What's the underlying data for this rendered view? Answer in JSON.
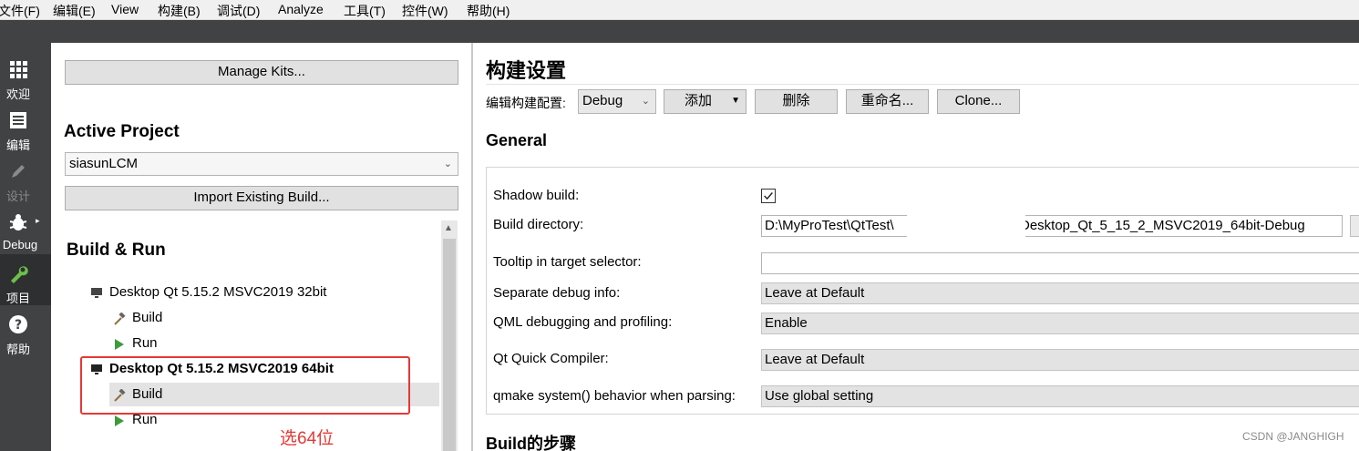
{
  "menu": [
    "文件(F)",
    "编辑(E)",
    "View",
    "构建(B)",
    "调试(D)",
    "Analyze",
    "工具(T)",
    "控件(W)",
    "帮助(H)"
  ],
  "modes": [
    {
      "label": "欢迎",
      "icon": "grid-icon"
    },
    {
      "label": "编辑",
      "icon": "document-icon"
    },
    {
      "label": "设计",
      "icon": "pencil-icon"
    },
    {
      "label": "Debug",
      "icon": "bug-icon"
    },
    {
      "label": "项目",
      "icon": "wrench-icon"
    },
    {
      "label": "帮助",
      "icon": "question-icon"
    }
  ],
  "left": {
    "manage_kits": "Manage Kits...",
    "active_project_title": "Active Project",
    "project_combo": "siasunLCM",
    "import_build": "Import Existing Build...",
    "build_run_title": "Build & Run",
    "kits": [
      {
        "name": "Desktop Qt 5.15.2 MSVC2019 32bit",
        "build": "Build",
        "run": "Run"
      },
      {
        "name": "Desktop Qt 5.15.2 MSVC2019 64bit",
        "build": "Build",
        "run": "Run"
      }
    ],
    "annotation": "选64位"
  },
  "right": {
    "title": "构建设置",
    "edit_config_label": "编辑构建配置:",
    "config_combo": "Debug",
    "add_button": "添加",
    "delete_button": "删除",
    "rename_button": "重命名...",
    "clone_button": "Clone...",
    "general_title": "General",
    "rows": {
      "shadow_build": "Shadow build:",
      "build_directory": "Build directory:",
      "build_directory_value_left": "D:\\MyProTest\\QtTest\\",
      "build_directory_value_right": "Desktop_Qt_5_15_2_MSVC2019_64bit-Debug",
      "tooltip_label": "Tooltip in target selector:",
      "tooltip_value": "",
      "separate_debug_label": "Separate debug info:",
      "separate_debug_value": "Leave at Default",
      "qml_debug_label": "QML debugging and profiling:",
      "qml_debug_value": "Enable",
      "quick_compiler_label": "Qt Quick Compiler:",
      "quick_compiler_value": "Leave at Default",
      "qmake_label": "qmake system() behavior when parsing:",
      "qmake_value": "Use global setting"
    },
    "build_steps_title": "Build的步骤"
  },
  "watermark": "CSDN @JANGHIGH",
  "colors": {
    "mode_bar": "#404244",
    "highlight": "#e53935",
    "run_green": "#3c9b3c"
  }
}
